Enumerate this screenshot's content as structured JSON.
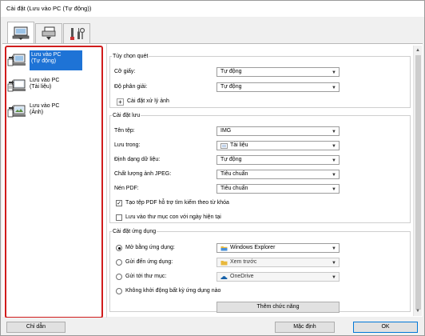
{
  "window": {
    "title": "Cài đặt (Lưu vào PC (Tự động))"
  },
  "tabs": [
    {
      "icon": "scan-from-computer-icon"
    },
    {
      "icon": "scan-from-panel-icon"
    },
    {
      "icon": "general-settings-icon"
    }
  ],
  "modes": [
    {
      "label": "Lưu vào PC\n(Tự động)",
      "selected": true
    },
    {
      "label": "Lưu vào PC\n(Tài liệu)",
      "selected": false
    },
    {
      "label": "Lưu vào PC\n(Ảnh)",
      "selected": false
    }
  ],
  "scan_options": {
    "legend": "Tùy chọn quét",
    "paper_size_label": "Cỡ giấy:",
    "paper_size_value": "Tự động",
    "resolution_label": "Độ phân giải:",
    "resolution_value": "Tự động",
    "image_settings_label": "Cài đặt xử lý ảnh"
  },
  "save_settings": {
    "legend": "Cài đặt lưu",
    "file_name_label": "Tên tệp:",
    "file_name_value": "IMG",
    "save_in_label": "Lưu trong:",
    "save_in_value": "Tài liệu",
    "data_format_label": "Định dạng dữ liệu:",
    "data_format_value": "Tự động",
    "jpeg_quality_label": "Chất lượng ảnh JPEG:",
    "jpeg_quality_value": "Tiêu chuẩn",
    "pdf_compression_label": "Nén PDF:",
    "pdf_compression_value": "Tiêu chuẩn",
    "keyword_pdf_label": "Tạo tệp PDF hỗ trợ tìm kiếm theo từ khóa",
    "keyword_pdf_checked": true,
    "subfolder_label": "Lưu vào thư mục con với ngày hiện tại",
    "subfolder_checked": false
  },
  "app_settings": {
    "legend": "Cài đặt ứng dụng",
    "open_with_label": "Mở bằng ứng dụng:",
    "open_with_value": "Windows Explorer",
    "send_to_app_label": "Gửi đến ứng dụng:",
    "send_to_app_value": "Xem trước",
    "send_to_folder_label": "Gửi tới thư mục:",
    "send_to_folder_value": "OneDrive",
    "do_not_start_label": "Không khởi động bất kỳ ứng dụng nào",
    "selected_option": "open_with",
    "add_function_label": "Thêm chức năng"
  },
  "footer": {
    "instructions_label": "Chỉ dẫn",
    "defaults_label": "Mặc định",
    "ok_label": "OK"
  },
  "colors": {
    "highlight": "#1e73d6",
    "red_outline": "#d01c1c",
    "folder": "#e8b83c",
    "onedrive": "#1560a8"
  }
}
